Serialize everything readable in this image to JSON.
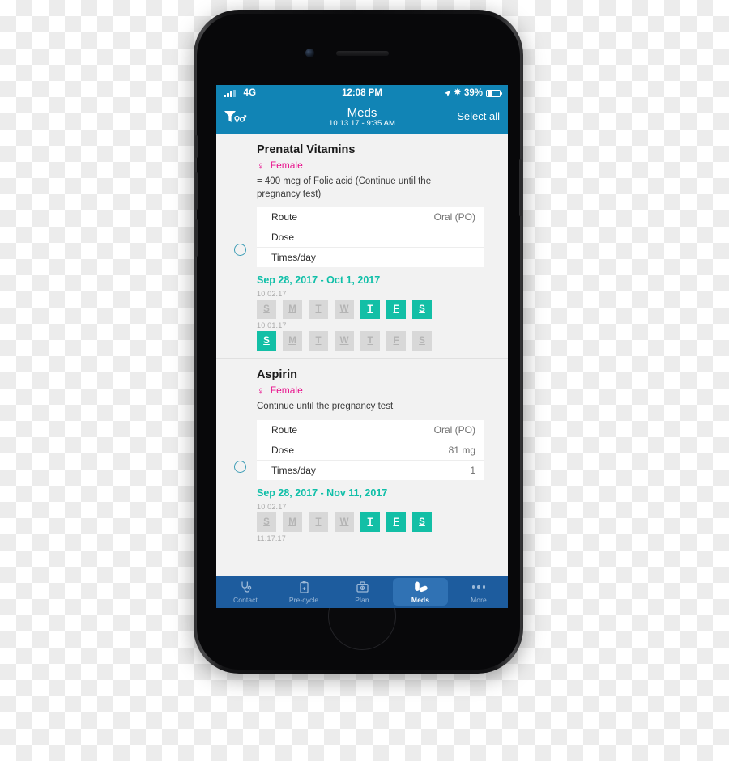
{
  "status_bar": {
    "signal_icon": "signal-bars-icon",
    "network": "4G",
    "time": "12:08 PM",
    "location_icon": "location-arrow-icon",
    "bluetooth_icon": "bluetooth-icon",
    "battery_percent": "39%",
    "battery_icon": "battery-icon"
  },
  "nav": {
    "filter_icon": "filter-gender-icon",
    "title": "Meds",
    "subtitle": "10.13.17 - 9:35 AM",
    "select_all": "Select all"
  },
  "meds": [
    {
      "name": "Prenatal Vitamins",
      "gender_symbol": "♀",
      "gender": "Female",
      "note": "= 400 mcg of Folic acid (Continue until the pregnancy test)",
      "details": [
        {
          "label": "Route",
          "value": "Oral (PO)"
        },
        {
          "label": "Dose",
          "value": ""
        },
        {
          "label": "Times/day",
          "value": ""
        }
      ],
      "date_range": "Sep 28, 2017 - Oct 1, 2017",
      "weeks": [
        {
          "label": "10.02.17",
          "days": [
            {
              "letter": "S",
              "active": false
            },
            {
              "letter": "M",
              "active": false
            },
            {
              "letter": "T",
              "active": false
            },
            {
              "letter": "W",
              "active": false
            },
            {
              "letter": "T",
              "active": true
            },
            {
              "letter": "F",
              "active": true
            },
            {
              "letter": "S",
              "active": true
            }
          ]
        },
        {
          "label": "10.01.17",
          "days": [
            {
              "letter": "S",
              "active": true
            },
            {
              "letter": "M",
              "active": false
            },
            {
              "letter": "T",
              "active": false
            },
            {
              "letter": "W",
              "active": false
            },
            {
              "letter": "T",
              "active": false
            },
            {
              "letter": "F",
              "active": false
            },
            {
              "letter": "S",
              "active": false
            }
          ]
        }
      ]
    },
    {
      "name": "Aspirin",
      "gender_symbol": "♀",
      "gender": "Female",
      "note": "Continue until the pregnancy test",
      "details": [
        {
          "label": "Route",
          "value": "Oral (PO)"
        },
        {
          "label": "Dose",
          "value": "81 mg"
        },
        {
          "label": "Times/day",
          "value": "1"
        }
      ],
      "date_range": "Sep 28, 2017 - Nov 11, 2017",
      "weeks": [
        {
          "label": "10.02.17",
          "days": [
            {
              "letter": "S",
              "active": false
            },
            {
              "letter": "M",
              "active": false
            },
            {
              "letter": "T",
              "active": false
            },
            {
              "letter": "W",
              "active": false
            },
            {
              "letter": "T",
              "active": true
            },
            {
              "letter": "F",
              "active": true
            },
            {
              "letter": "S",
              "active": true
            }
          ]
        },
        {
          "label": "11.17.17",
          "days": []
        }
      ]
    }
  ],
  "tabs": [
    {
      "label": "Contact",
      "icon": "stethoscope-icon",
      "active": false
    },
    {
      "label": "Pre-cycle",
      "icon": "clipboard-icon",
      "active": false
    },
    {
      "label": "Plan",
      "icon": "briefcase-icon",
      "active": false
    },
    {
      "label": "Meds",
      "icon": "pills-icon",
      "active": true
    },
    {
      "label": "More",
      "icon": "more-dots-icon",
      "active": false
    }
  ],
  "colors": {
    "header_blue": "#1184b5",
    "teal": "#13bfa6",
    "pink": "#e8118c",
    "tabbar_blue": "#1d5c9e",
    "tab_active_blue": "#3072b4"
  }
}
